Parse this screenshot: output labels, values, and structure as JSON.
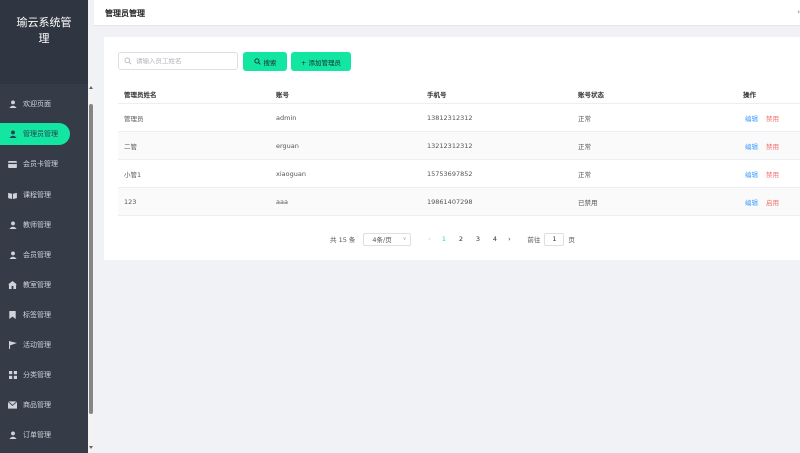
{
  "sidebar": {
    "title": "瑜云系统管理",
    "items": [
      {
        "label": "欢迎页面",
        "icon": "user-icon"
      },
      {
        "label": "管理员管理",
        "icon": "user-icon",
        "active": true
      },
      {
        "label": "会员卡管理",
        "icon": "card-icon"
      },
      {
        "label": "课程管理",
        "icon": "book-icon"
      },
      {
        "label": "教师管理",
        "icon": "user-icon"
      },
      {
        "label": "会员管理",
        "icon": "user-icon"
      },
      {
        "label": "教室管理",
        "icon": "home-icon"
      },
      {
        "label": "标签管理",
        "icon": "bookmark-icon"
      },
      {
        "label": "活动管理",
        "icon": "flag-icon"
      },
      {
        "label": "分类管理",
        "icon": "grid-icon"
      },
      {
        "label": "商品管理",
        "icon": "mail-icon"
      },
      {
        "label": "订单管理",
        "icon": "user-icon"
      }
    ]
  },
  "header": {
    "title": "管理员管理"
  },
  "toolbar": {
    "search_placeholder": "请输入员工姓名",
    "search_value": "",
    "search_label": "搜索",
    "add_label": "+ 添加管理员"
  },
  "table": {
    "columns": [
      "管理员姓名",
      "账号",
      "手机号",
      "账号状态",
      "操作"
    ],
    "rows": [
      {
        "name": "管理员",
        "account": "admin",
        "phone": "13812312312",
        "status": "正常",
        "edit": "编辑",
        "toggle": "禁用"
      },
      {
        "name": "二管",
        "account": "erguan",
        "phone": "13212312312",
        "status": "正常",
        "edit": "编辑",
        "toggle": "禁用"
      },
      {
        "name": "小管1",
        "account": "xiaoguan",
        "phone": "15753697852",
        "status": "正常",
        "edit": "编辑",
        "toggle": "禁用"
      },
      {
        "name": "123",
        "account": "aaa",
        "phone": "19861407298",
        "status": "已禁用",
        "edit": "编辑",
        "toggle": "启用"
      }
    ]
  },
  "pagination": {
    "total": "共 15 条",
    "page_size": "4条/页",
    "pages": [
      "1",
      "2",
      "3",
      "4"
    ],
    "current_page": "1",
    "goto_label": "前往",
    "goto_value": "1",
    "page_suffix": "页"
  },
  "colors": {
    "accent": "#12e6a1",
    "sidebar": "#353c48",
    "link": "#409eff",
    "danger": "#f56c6c"
  }
}
